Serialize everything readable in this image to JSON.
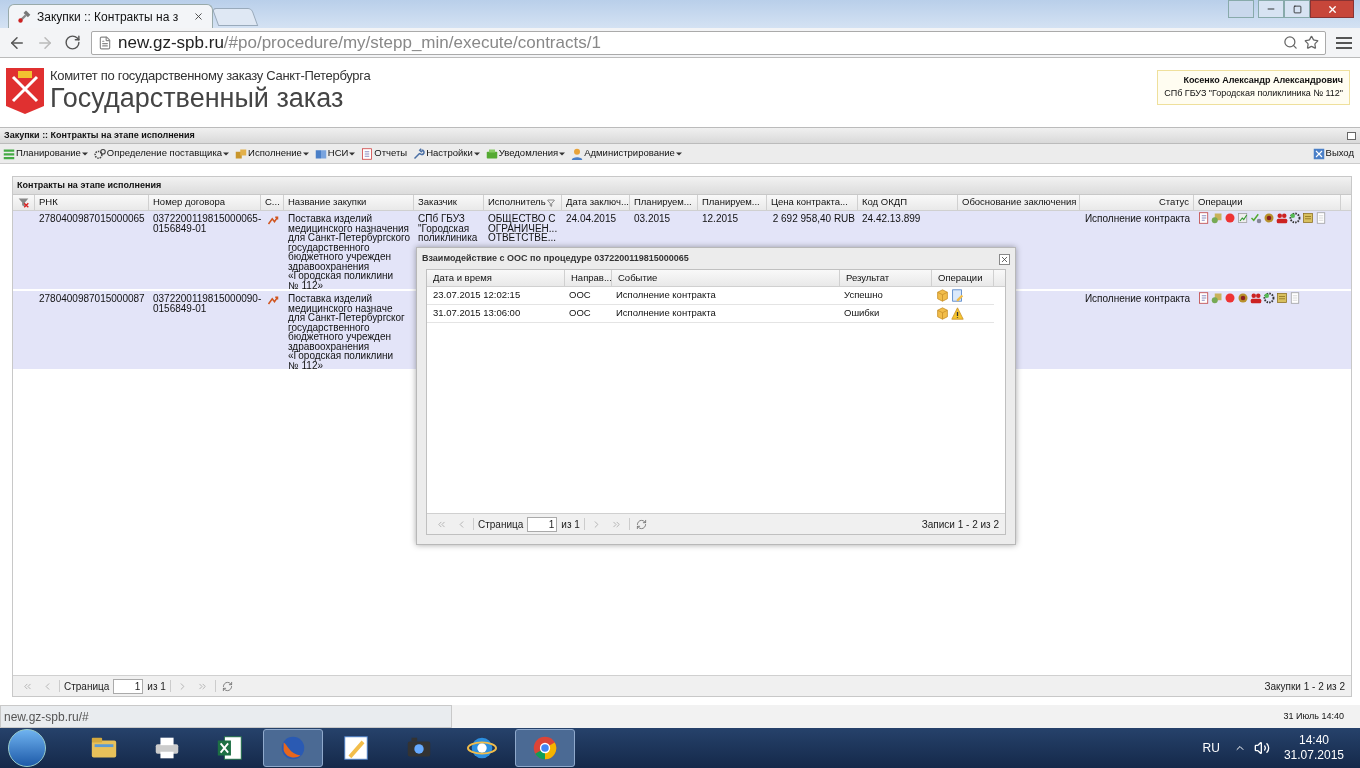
{
  "browser": {
    "tab_title": "Закупки :: Контракты на з",
    "url_host": "new.gz-spb.ru",
    "url_path": "/#po/procedure/my/stepp_min/execute/contracts/1"
  },
  "header": {
    "committee": "Комитет по государственному заказу Санкт-Петербурга",
    "title": "Государственный заказ",
    "user_name": "Косенко Александр Александрович",
    "user_org": "СПб ГБУЗ \"Городская поликлиника № 112\""
  },
  "panel_title": "Закупки :: Контракты на этапе исполнения",
  "menu": [
    {
      "label": "Планирование",
      "kind": "rows",
      "has_menu": true
    },
    {
      "label": "Определение поставщика",
      "kind": "gears",
      "has_menu": true
    },
    {
      "label": "Исполнение",
      "kind": "boxes",
      "has_menu": true
    },
    {
      "label": "НСИ",
      "kind": "book",
      "has_menu": true
    },
    {
      "label": "Отчеты",
      "kind": "report",
      "has_menu": false
    },
    {
      "label": "Настройки",
      "kind": "wrench",
      "has_menu": true
    },
    {
      "label": "Уведомления",
      "kind": "tray",
      "has_menu": true
    },
    {
      "label": "Администрирование",
      "kind": "user",
      "has_menu": true
    }
  ],
  "logout": "Выход",
  "grid": {
    "title": "Контракты на этапе исполнения",
    "columns": [
      "РНК",
      "Номер договора",
      "С...",
      "Название закупки",
      "Заказчик",
      "Исполнитель",
      "Дата заключ...",
      "Планируем...",
      "Планируем...",
      "Цена контракта...",
      "Код ОКДП",
      "Обоснование заключения",
      "Статус",
      "Операции"
    ],
    "rows": [
      {
        "selected": true,
        "rnk": "2780400987015000065",
        "contract_number": "0372200119815000065-0156849-01",
        "name_lines": [
          "Поставка изделий",
          "медицинского назначения",
          "для Санкт-Петербургского",
          "государственного",
          "бюджетного учрежден",
          "здравоохранения",
          "«Городская поликлини",
          "№ 112»"
        ],
        "customer_lines": [
          "СПб ГБУЗ",
          "\"Городская",
          "поликлиника"
        ],
        "contractor_lines": [
          "ОБЩЕСТВО С",
          "ОГРАНИЧЕН...",
          "ОТВЕТСТВЕ..."
        ],
        "date_concluded": "24.04.2015",
        "planned_start": "03.2015",
        "planned_end": "12.2015",
        "price": "2 692 958,40 RUB",
        "okdp": "24.42.13.899",
        "status": "Исполнение контракта",
        "operations": [
          {
            "kind": "document"
          },
          {
            "kind": "scroll-hand"
          },
          {
            "kind": "red-dot"
          },
          {
            "kind": "chart"
          },
          {
            "kind": "check"
          },
          {
            "kind": "emblem"
          },
          {
            "kind": "people"
          },
          {
            "kind": "gear"
          },
          {
            "kind": "scroll"
          },
          {
            "kind": "page"
          }
        ]
      },
      {
        "selected": true,
        "rnk": "2780400987015000087",
        "contract_number": "0372200119815000090-0156849-01",
        "name_lines": [
          "Поставка изделий",
          "медицинского назначе",
          "для Санкт-Петербургског",
          "государственного",
          "бюджетного учрежден",
          "здравоохранения",
          "«Городская поликлини",
          "№ 112»"
        ],
        "status": "Исполнение контракта",
        "operations": [
          {
            "kind": "document"
          },
          {
            "kind": "scroll-hand"
          },
          {
            "kind": "red-dot"
          },
          {
            "kind": "emblem"
          },
          {
            "kind": "people"
          },
          {
            "kind": "gear"
          },
          {
            "kind": "scroll"
          },
          {
            "kind": "page"
          }
        ]
      }
    ],
    "pager": {
      "page_label": "Страница",
      "page": "1",
      "of": "из 1",
      "summary": "Закупки 1 - 2 из 2"
    }
  },
  "dialog": {
    "title": "Взаимодействие с ООС по процедуре 0372200119815000065",
    "columns": [
      "Дата и время",
      "Направ...",
      "Событие",
      "Результат",
      "Операции"
    ],
    "rows": [
      {
        "datetime": "23.07.2015 12:02:15",
        "direction": "ООС",
        "event": "Исполнение контракта",
        "result": "Успешно",
        "operations": [
          {
            "kind": "package"
          },
          {
            "kind": "edit"
          }
        ]
      },
      {
        "datetime": "31.07.2015 13:06:00",
        "direction": "ООС",
        "event": "Исполнение контракта",
        "result": "Ошибки",
        "operations": [
          {
            "kind": "package"
          },
          {
            "kind": "warning"
          }
        ]
      }
    ],
    "pager": {
      "page_label": "Страница",
      "page": "1",
      "of": "из 1",
      "summary": "Записи 1 - 2 из 2"
    }
  },
  "status_url": "new.gz-spb.ru/#",
  "status_date": "31 Июль 14:40",
  "taskbar": {
    "apps": [
      {
        "kind": "folder",
        "active": false
      },
      {
        "kind": "printer",
        "active": false
      },
      {
        "kind": "spreadsheet",
        "active": false
      },
      {
        "kind": "fox",
        "active": true
      },
      {
        "kind": "pen",
        "active": false
      },
      {
        "kind": "film",
        "active": false
      },
      {
        "kind": "globe-e",
        "active": false
      },
      {
        "kind": "chrome",
        "active": true
      }
    ],
    "language": "RU",
    "time": "14:40",
    "date": "31.07.2015"
  }
}
